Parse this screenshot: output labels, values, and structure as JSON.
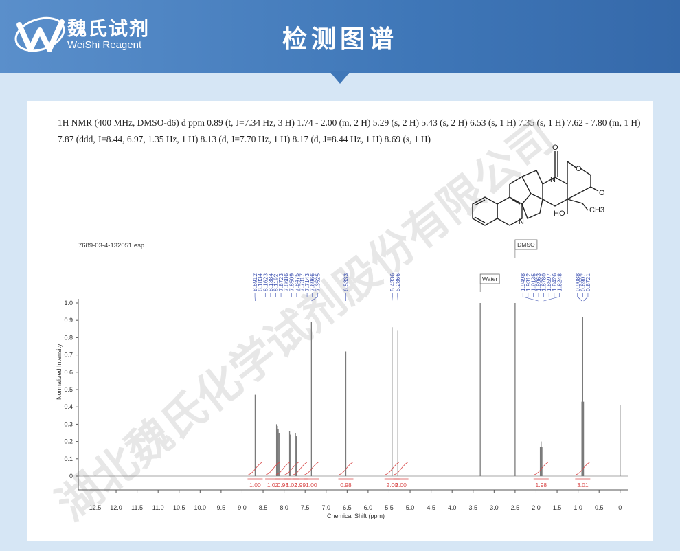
{
  "header": {
    "brand_cn": "魏氏试剂",
    "brand_en": "WeiShi Reagent",
    "title": "检测图谱"
  },
  "nmr": {
    "line1": "1H NMR (400 MHz, DMSO-d6) d ppm 0.89 (t, J=7.34 Hz, 3 H) 1.74 - 2.00 (m, 2 H) 5.29 (s, 2 H) 5.43 (s, 2 H) 6.53 (s, 1 H) 7.35 (s, 1 H) 7.62 - 7.80 (m, 1 H)",
    "line2": "7.87 (ddd, J=8.44, 6.97, 1.35 Hz, 1 H) 8.13 (d, J=7.70 Hz, 1 H) 8.17 (d, J=8.44 Hz, 1 H) 8.69 (s, 1 H)"
  },
  "watermark": "湖北魏氏化学试剂股份有限公司",
  "structure": {
    "atom_o1": "O",
    "atom_o2": "O",
    "atom_o3": "O",
    "atom_n1": "N",
    "atom_n2": "N",
    "atom_ho": "HO",
    "atom_ch3": "CH3"
  },
  "chart_data": {
    "type": "line",
    "file_label": "7689-03-4-132051.esp",
    "xlabel": "Chemical Shift (ppm)",
    "ylabel": "Normalized Intensity",
    "xlim": [
      12.9,
      -0.2
    ],
    "ylim": [
      0,
      1.0
    ],
    "x_ticks": [
      12.5,
      12.0,
      11.5,
      11.0,
      10.5,
      10.0,
      9.5,
      9.0,
      8.5,
      8.0,
      7.5,
      7.0,
      6.5,
      6.0,
      5.5,
      5.0,
      4.5,
      4.0,
      3.5,
      3.0,
      2.5,
      2.0,
      1.5,
      1.0,
      0.5,
      0
    ],
    "x_tick_labels": [
      "12.5",
      "12.0",
      "11.5",
      "11.0",
      "10.5",
      "10.0",
      "9.5",
      "9.0",
      "8.5",
      "8.0",
      "7.5",
      "7.0",
      "6.5",
      "6.0",
      "5.5",
      "5.0",
      "4.5",
      "4.0",
      "3.5",
      "3.0",
      "2.5",
      "2.0",
      "1.5",
      "1.0",
      "0.5",
      "0"
    ],
    "y_ticks": [
      0,
      0.1,
      0.2,
      0.3,
      0.4,
      0.5,
      0.6,
      0.7,
      0.8,
      0.9,
      1.0
    ],
    "y_tick_labels": [
      "0",
      "0.1",
      "0.2",
      "0.3",
      "0.4",
      "0.5",
      "0.6",
      "0.7",
      "0.8",
      "0.9",
      "1.0"
    ],
    "peaks": [
      {
        "x": 8.69,
        "y": 0.47
      },
      {
        "x": 8.18,
        "y": 0.3
      },
      {
        "x": 8.16,
        "y": 0.29
      },
      {
        "x": 8.14,
        "y": 0.27
      },
      {
        "x": 8.12,
        "y": 0.25
      },
      {
        "x": 7.87,
        "y": 0.26
      },
      {
        "x": 7.85,
        "y": 0.24
      },
      {
        "x": 7.73,
        "y": 0.25
      },
      {
        "x": 7.71,
        "y": 0.23
      },
      {
        "x": 7.35,
        "y": 0.89
      },
      {
        "x": 6.53,
        "y": 0.72
      },
      {
        "x": 5.43,
        "y": 0.86
      },
      {
        "x": 5.29,
        "y": 0.84
      },
      {
        "x": 3.33,
        "y": 1.0
      },
      {
        "x": 2.5,
        "y": 1.0
      },
      {
        "x": 1.9,
        "y": 0.17
      },
      {
        "x": 1.88,
        "y": 0.2
      },
      {
        "x": 1.86,
        "y": 0.17
      },
      {
        "x": 0.91,
        "y": 0.43
      },
      {
        "x": 0.89,
        "y": 0.92
      },
      {
        "x": 0.87,
        "y": 0.43
      },
      {
        "x": 0.0,
        "y": 0.41
      }
    ],
    "peak_labels_group1": [
      "8.6912",
      "8.1834",
      "8.1623",
      "8.1384",
      "8.1192",
      "7.8723",
      "7.8686",
      "7.8509",
      "7.8475",
      "7.7317",
      "7.7143",
      "7.6966",
      "7.3525"
    ],
    "peak_labels_group2": [
      "6.5333"
    ],
    "peak_labels_group3": [
      "5.4336",
      "5.2866"
    ],
    "peak_labels_group4": [
      "1.9498",
      "1.9312",
      "1.9135",
      "1.8963",
      "1.8780",
      "1.8597",
      "1.8426",
      "1.8248"
    ],
    "peak_labels_group5": [
      "0.9088",
      "0.8907",
      "0.8721"
    ],
    "annotations": [
      {
        "x": 3.33,
        "text": "Water"
      },
      {
        "x": 2.5,
        "text": "DMSO"
      }
    ],
    "integrals": [
      {
        "x": 8.69,
        "text": "1.00"
      },
      {
        "x": 8.27,
        "text": "1.02"
      },
      {
        "x": 8.03,
        "text": "0.98"
      },
      {
        "x": 7.82,
        "text": "1.02"
      },
      {
        "x": 7.62,
        "text": "0.99"
      },
      {
        "x": 7.35,
        "text": "1.00"
      },
      {
        "x": 6.53,
        "text": "0.98"
      },
      {
        "x": 5.43,
        "text": "2.00"
      },
      {
        "x": 5.22,
        "text": "2.00"
      },
      {
        "x": 1.88,
        "text": "1.98"
      },
      {
        "x": 0.89,
        "text": "3.01"
      }
    ]
  }
}
